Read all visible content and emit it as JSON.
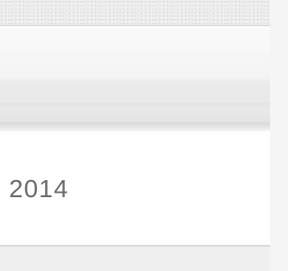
{
  "date_row": {
    "year_text": "2014"
  }
}
